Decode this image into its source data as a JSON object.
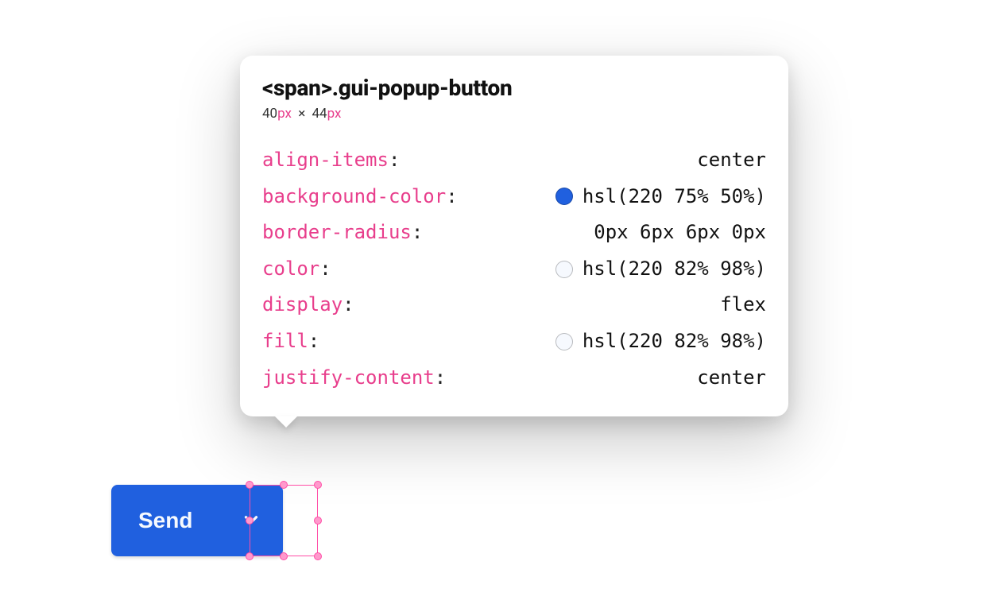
{
  "inspector": {
    "selector_tag": "<span>",
    "selector_class": ".gui-popup-button",
    "width": "40",
    "height": "44",
    "unit": "px",
    "multiply": "×",
    "properties": [
      {
        "name": "align-items",
        "value": "center",
        "swatch": null
      },
      {
        "name": "background-color",
        "value": "hsl(220 75% 50%)",
        "swatch": "hsl(220 75% 50%)"
      },
      {
        "name": "border-radius",
        "value": "0px 6px 6px 0px",
        "swatch": null
      },
      {
        "name": "color",
        "value": "hsl(220 82% 98%)",
        "swatch": "hsl(220 82% 98%)"
      },
      {
        "name": "display",
        "value": "flex",
        "swatch": null
      },
      {
        "name": "fill",
        "value": "hsl(220 82% 98%)",
        "swatch": "hsl(220 82% 98%)"
      },
      {
        "name": "justify-content",
        "value": "center",
        "swatch": null
      }
    ]
  },
  "button": {
    "label": "Send"
  }
}
